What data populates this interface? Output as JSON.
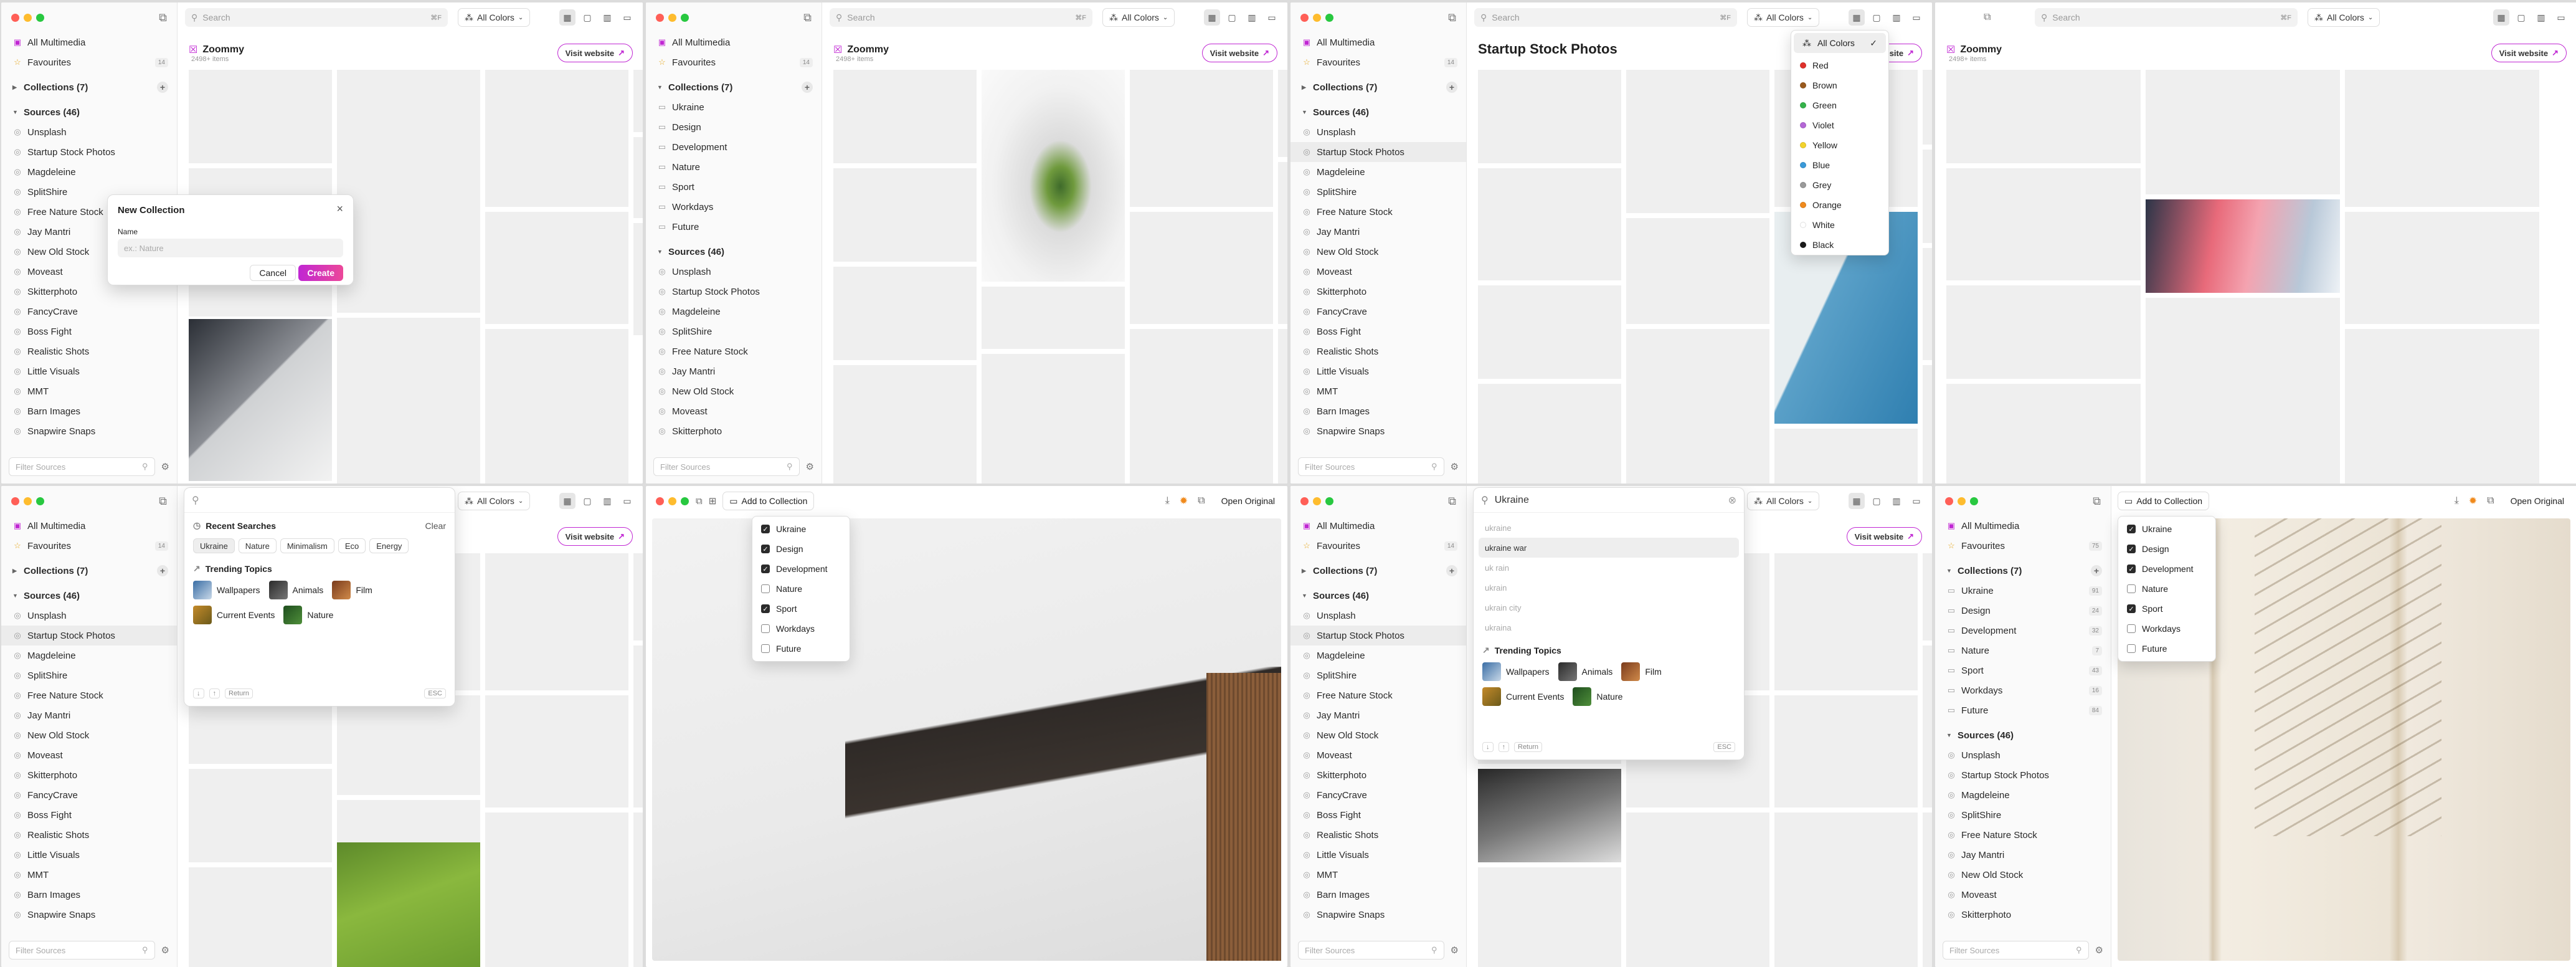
{
  "nav": {
    "all": "All Multimedia",
    "fav": "Favourites",
    "fav_count": "14",
    "fav_count_alt": "75",
    "collections_head": "Collections (7)",
    "sources_head": "Sources (46)",
    "collections": [
      {
        "label": "Ukraine",
        "count": "91"
      },
      {
        "label": "Design",
        "count": "24"
      },
      {
        "label": "Development",
        "count": "32"
      },
      {
        "label": "Nature",
        "count": "7"
      },
      {
        "label": "Sport",
        "count": "43"
      },
      {
        "label": "Workdays",
        "count": "16"
      },
      {
        "label": "Future",
        "count": "84"
      }
    ],
    "sources": [
      "Unsplash",
      "Startup Stock Photos",
      "Magdeleine",
      "SplitShire",
      "Free Nature Stock",
      "Jay Mantri",
      "New Old Stock",
      "Moveast",
      "Skitterphoto",
      "FancyCrave",
      "Boss Fight",
      "Realistic Shots",
      "Little Visuals",
      "MMT",
      "Barn Images",
      "Snapwire Snaps"
    ],
    "filter_placeholder": "Filter Sources"
  },
  "toolbar": {
    "search_placeholder": "Search",
    "search_kbd": "⌘F",
    "colors_label": "All Colors",
    "add_to_collection": "Add to Collection",
    "open_original": "Open Original"
  },
  "source": {
    "name": "Zoommy",
    "items": "2498+ items",
    "visit": "Visit website",
    "startup_title": "Startup Stock Photos"
  },
  "modal": {
    "title": "New Collection",
    "name_label": "Name",
    "placeholder": "ex.: Nature",
    "cancel": "Cancel",
    "create": "Create"
  },
  "colors": {
    "options": [
      {
        "label": "All Colors",
        "hex": ""
      },
      {
        "label": "Red",
        "hex": "#e0312b"
      },
      {
        "label": "Brown",
        "hex": "#9a5a1e"
      },
      {
        "label": "Green",
        "hex": "#35b34a"
      },
      {
        "label": "Violet",
        "hex": "#b467d6"
      },
      {
        "label": "Yellow",
        "hex": "#f3d32c"
      },
      {
        "label": "Blue",
        "hex": "#3a9ad9"
      },
      {
        "label": "Grey",
        "hex": "#9a9a9a"
      },
      {
        "label": "Orange",
        "hex": "#f08a1c"
      },
      {
        "label": "White",
        "hex": "#ffffff"
      },
      {
        "label": "Black",
        "hex": "#1a1a1a"
      }
    ]
  },
  "recent": {
    "title": "Recent Searches",
    "clear": "Clear",
    "chips": [
      "Ukraine",
      "Nature",
      "Minimalism",
      "Eco",
      "Energy"
    ],
    "trending": "Trending Topics",
    "topics": [
      "Wallpapers",
      "Animals",
      "Film",
      "Current Events",
      "Nature"
    ],
    "return_label": "Return",
    "esc_label": "ESC"
  },
  "suggest": {
    "query": "Ukraine",
    "items": [
      "ukraine",
      "ukraine war",
      "uk rain",
      "ukrain",
      "ukrain city",
      "ukraina"
    ]
  },
  "collection_menu": {
    "items": [
      {
        "label": "Ukraine",
        "checked": true
      },
      {
        "label": "Design",
        "checked": true
      },
      {
        "label": "Development",
        "checked": true
      },
      {
        "label": "Nature",
        "checked": false
      },
      {
        "label": "Sport",
        "checked": true
      },
      {
        "label": "Workdays",
        "checked": false
      },
      {
        "label": "Future",
        "checked": false
      }
    ]
  },
  "accent": "#c026d3"
}
